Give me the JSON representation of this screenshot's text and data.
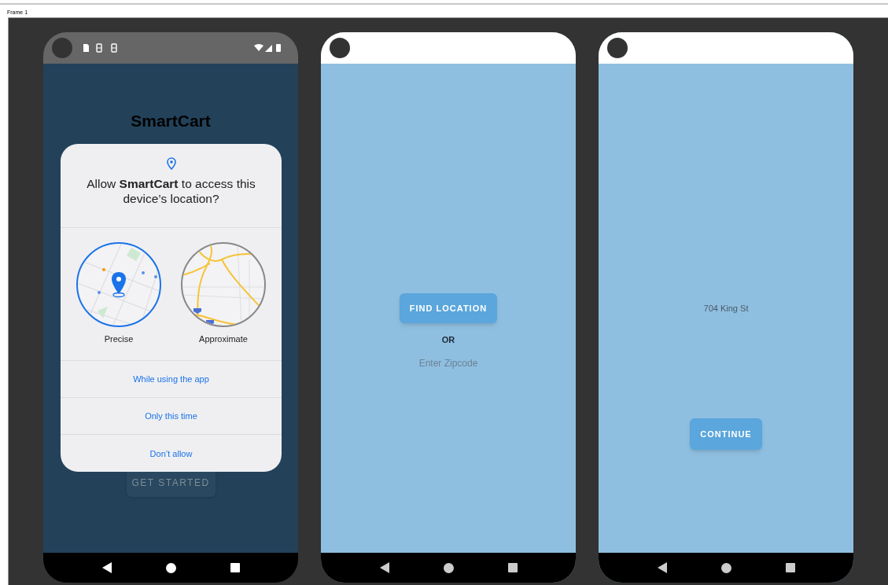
{
  "frame_label": "Frame 1",
  "screens": [
    {
      "kind": "permission",
      "app_title": "SmartCart",
      "button": "GET STARTED",
      "dialog": {
        "prompt": "Allow **SmartCart** to access this device’s location?",
        "options": [
          {
            "label": "Precise",
            "selected": true
          },
          {
            "label": "Approximate",
            "selected": false
          }
        ],
        "actions": [
          "While using the app",
          "Only this time",
          "Don’t allow"
        ]
      }
    },
    {
      "kind": "find",
      "button": "FIND LOCATION",
      "separator": "OR",
      "zipcode": {
        "placeholder": "Enter Zipcode"
      }
    },
    {
      "kind": "confirm",
      "address": "704 King St",
      "button": "CONTINUE"
    }
  ]
}
